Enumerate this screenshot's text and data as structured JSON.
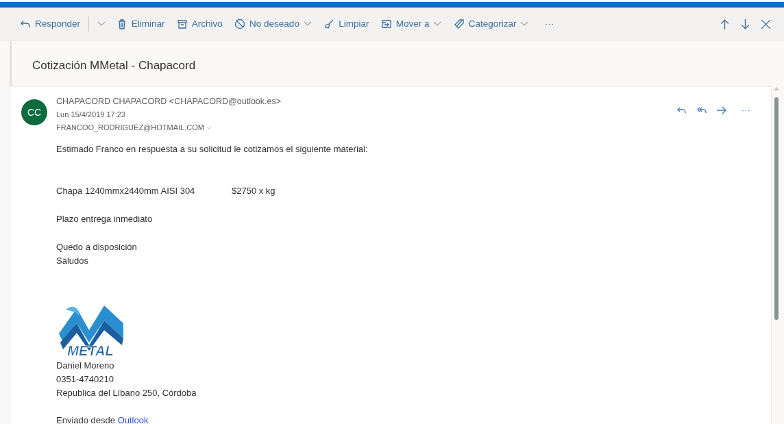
{
  "toolbar": {
    "actions": [
      {
        "label": "Responder",
        "kind": "split"
      },
      {
        "label": "Eliminar",
        "kind": "plain"
      },
      {
        "label": "Archivo",
        "kind": "plain"
      },
      {
        "label": "No deseado",
        "kind": "dropdown"
      },
      {
        "label": "Limpiar",
        "kind": "plain"
      },
      {
        "label": "Mover a",
        "kind": "dropdown"
      },
      {
        "label": "Categorizar",
        "kind": "dropdown"
      }
    ],
    "more": "···"
  },
  "subject": "Cotización MMetal - Chapacord",
  "message": {
    "avatar": "CC",
    "from": "CHAPACORD CHAPACORD <CHAPACORD@outlook.es>",
    "date": "Lun 15/4/2019 17:23",
    "to": "FRANCOO_RODRIGUEZ@HOTMAIL.COM",
    "more": "···",
    "body": [
      {
        "kind": "para",
        "lines": [
          "Estimado Franco en respuesta a su solicitud le cotizamos el siguiente material:"
        ]
      },
      {
        "kind": "spacer"
      },
      {
        "kind": "item",
        "text": "Chapa 1240mmx2440mm AISI 304",
        "price": "$2750 x kg"
      },
      {
        "kind": "para",
        "lines": [
          "Plazo entrega inmediato"
        ]
      },
      {
        "kind": "para",
        "lines": [
          "Quedo a disposición",
          "Saludos"
        ]
      },
      {
        "kind": "spacer"
      },
      {
        "kind": "logo",
        "text": "METAL"
      },
      {
        "kind": "lines",
        "lines": [
          "Daniel Moreno",
          "0351-4740210",
          "Republica del Líbano 250, Córdoba"
        ]
      },
      {
        "kind": "sent",
        "text": "Enviado desde",
        "link": "Outlook"
      }
    ]
  }
}
